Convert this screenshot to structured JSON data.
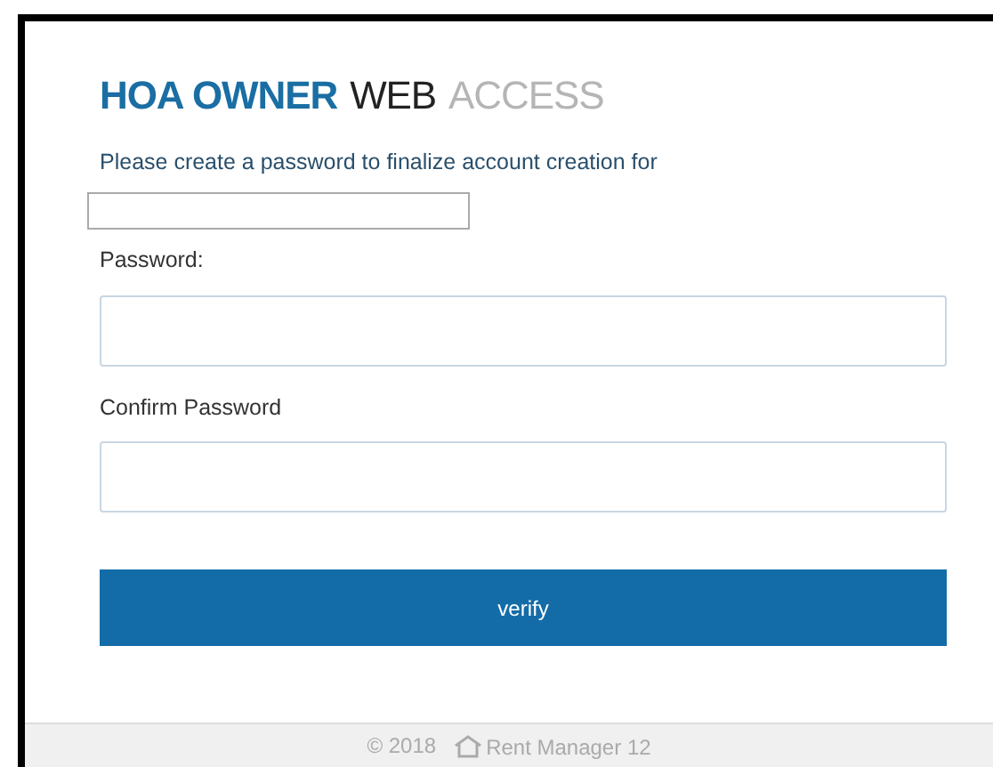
{
  "header": {
    "title_parts": [
      {
        "text": "HOA OWNER",
        "kind": "strong"
      },
      {
        "text": "WEB",
        "kind": "dark"
      },
      {
        "text": "ACCESS",
        "kind": "light"
      }
    ]
  },
  "intro": "Please create a password to finalize account creation for",
  "fields": [
    {
      "label": "Password:"
    },
    {
      "label": "Confirm Password"
    }
  ],
  "button": "verify",
  "footer": {
    "copyright": "© 2018",
    "brand": "Rent Manager 12"
  }
}
